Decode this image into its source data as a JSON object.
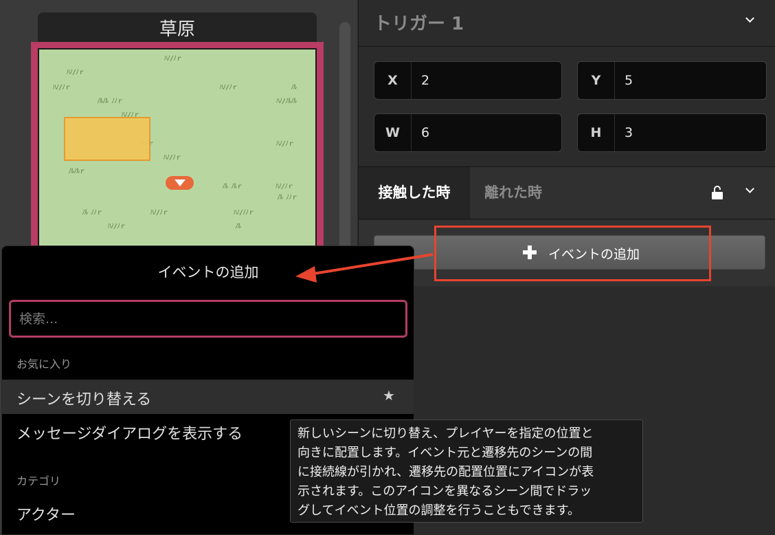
{
  "scene": {
    "title": "草原"
  },
  "sidebar": {
    "title": "トリガー 1",
    "fields": {
      "x": {
        "label": "X",
        "value": "2"
      },
      "y": {
        "label": "Y",
        "value": "5"
      },
      "w": {
        "label": "W",
        "value": "6"
      },
      "h": {
        "label": "H",
        "value": "3"
      }
    },
    "tabs": [
      {
        "label": "接触した時",
        "active": true
      },
      {
        "label": "離れた時",
        "active": false
      }
    ],
    "add_event_label": "イベントの追加"
  },
  "popup": {
    "title": "イベントの追加",
    "search_placeholder": "検索...",
    "favorites_label": "お気に入り",
    "items": [
      {
        "label": "シーンを切り替える",
        "starred": true,
        "selected": true
      },
      {
        "label": "メッセージダイアログを表示する",
        "starred": false,
        "selected": false
      }
    ],
    "category_label": "カテゴリ",
    "category_items": [
      {
        "label": "アクター"
      }
    ]
  },
  "tooltip": {
    "text": "新しいシーンに切り替え、プレイヤーを指定の位置と\n向きに配置します。イベント元と遷移先のシーンの間\nに接続線が引かれ、遷移先の配置位置にアイコンが表\n示されます。このアイコンを異なるシーン間でドラッ\nグしてイベント位置の調整を行うこともできます。"
  },
  "colors": {
    "accent": "#b43d67",
    "annotation": "#e8442e",
    "trigger_fill": "#f0c75a",
    "map_bg": "#b8d7a0"
  }
}
